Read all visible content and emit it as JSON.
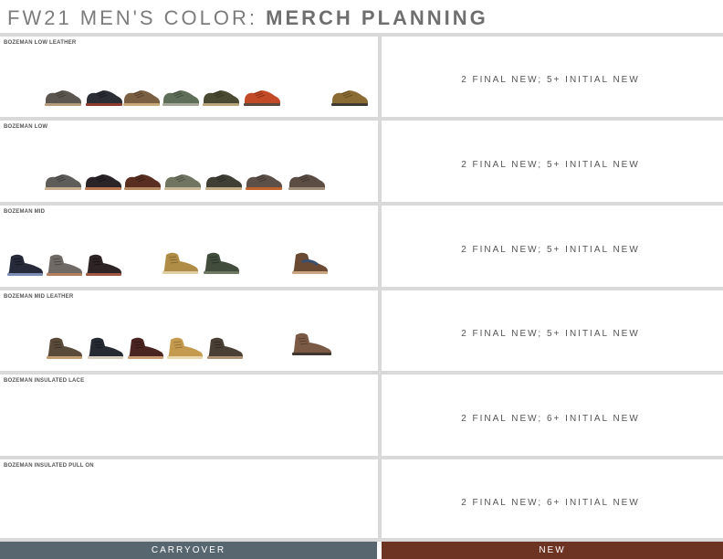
{
  "header": {
    "title_light": "FW21 MEN'S COLOR: ",
    "title_bold": "MERCH PLANNING"
  },
  "rows": [
    {
      "label": "BOZEMAN LOW LEATHER",
      "new_text": "2 FINAL NEW; 5+ INITIAL NEW"
    },
    {
      "label": "BOZEMAN LOW",
      "new_text": "2 FINAL NEW; 5+ INITIAL NEW"
    },
    {
      "label": "BOZEMAN MID",
      "new_text": "2 FINAL NEW; 5+ INITIAL NEW"
    },
    {
      "label": "BOZEMAN MID LEATHER",
      "new_text": "2 FINAL NEW; 5+ INITIAL NEW"
    },
    {
      "label": "BOZEMAN INSULATED LACE",
      "new_text": "2 FINAL NEW; 6+ INITIAL NEW"
    },
    {
      "label": "BOZEMAN INSULATED PULL ON",
      "new_text": "2 FINAL NEW; 6+ INITIAL NEW"
    }
  ],
  "footer": {
    "carryover": "CARRYOVER",
    "new": "NEW"
  },
  "colors": {
    "carryover_bar": "#58666f",
    "new_bar": "#6e3423",
    "divider": "#d9d9d9"
  }
}
